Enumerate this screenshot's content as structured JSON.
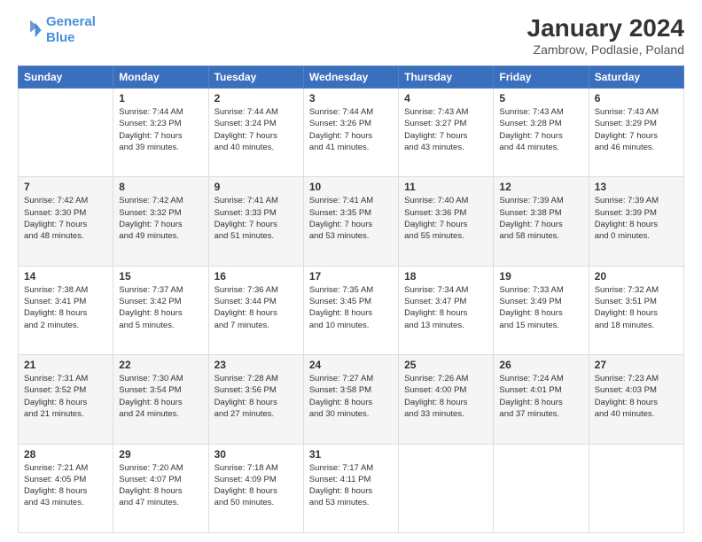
{
  "logo": {
    "line1": "General",
    "line2": "Blue"
  },
  "title": "January 2024",
  "subtitle": "Zambrow, Podlasie, Poland",
  "days_header": [
    "Sunday",
    "Monday",
    "Tuesday",
    "Wednesday",
    "Thursday",
    "Friday",
    "Saturday"
  ],
  "weeks": [
    [
      {
        "num": "",
        "info": ""
      },
      {
        "num": "1",
        "info": "Sunrise: 7:44 AM\nSunset: 3:23 PM\nDaylight: 7 hours\nand 39 minutes."
      },
      {
        "num": "2",
        "info": "Sunrise: 7:44 AM\nSunset: 3:24 PM\nDaylight: 7 hours\nand 40 minutes."
      },
      {
        "num": "3",
        "info": "Sunrise: 7:44 AM\nSunset: 3:26 PM\nDaylight: 7 hours\nand 41 minutes."
      },
      {
        "num": "4",
        "info": "Sunrise: 7:43 AM\nSunset: 3:27 PM\nDaylight: 7 hours\nand 43 minutes."
      },
      {
        "num": "5",
        "info": "Sunrise: 7:43 AM\nSunset: 3:28 PM\nDaylight: 7 hours\nand 44 minutes."
      },
      {
        "num": "6",
        "info": "Sunrise: 7:43 AM\nSunset: 3:29 PM\nDaylight: 7 hours\nand 46 minutes."
      }
    ],
    [
      {
        "num": "7",
        "info": "Sunrise: 7:42 AM\nSunset: 3:30 PM\nDaylight: 7 hours\nand 48 minutes."
      },
      {
        "num": "8",
        "info": "Sunrise: 7:42 AM\nSunset: 3:32 PM\nDaylight: 7 hours\nand 49 minutes."
      },
      {
        "num": "9",
        "info": "Sunrise: 7:41 AM\nSunset: 3:33 PM\nDaylight: 7 hours\nand 51 minutes."
      },
      {
        "num": "10",
        "info": "Sunrise: 7:41 AM\nSunset: 3:35 PM\nDaylight: 7 hours\nand 53 minutes."
      },
      {
        "num": "11",
        "info": "Sunrise: 7:40 AM\nSunset: 3:36 PM\nDaylight: 7 hours\nand 55 minutes."
      },
      {
        "num": "12",
        "info": "Sunrise: 7:39 AM\nSunset: 3:38 PM\nDaylight: 7 hours\nand 58 minutes."
      },
      {
        "num": "13",
        "info": "Sunrise: 7:39 AM\nSunset: 3:39 PM\nDaylight: 8 hours\nand 0 minutes."
      }
    ],
    [
      {
        "num": "14",
        "info": "Sunrise: 7:38 AM\nSunset: 3:41 PM\nDaylight: 8 hours\nand 2 minutes."
      },
      {
        "num": "15",
        "info": "Sunrise: 7:37 AM\nSunset: 3:42 PM\nDaylight: 8 hours\nand 5 minutes."
      },
      {
        "num": "16",
        "info": "Sunrise: 7:36 AM\nSunset: 3:44 PM\nDaylight: 8 hours\nand 7 minutes."
      },
      {
        "num": "17",
        "info": "Sunrise: 7:35 AM\nSunset: 3:45 PM\nDaylight: 8 hours\nand 10 minutes."
      },
      {
        "num": "18",
        "info": "Sunrise: 7:34 AM\nSunset: 3:47 PM\nDaylight: 8 hours\nand 13 minutes."
      },
      {
        "num": "19",
        "info": "Sunrise: 7:33 AM\nSunset: 3:49 PM\nDaylight: 8 hours\nand 15 minutes."
      },
      {
        "num": "20",
        "info": "Sunrise: 7:32 AM\nSunset: 3:51 PM\nDaylight: 8 hours\nand 18 minutes."
      }
    ],
    [
      {
        "num": "21",
        "info": "Sunrise: 7:31 AM\nSunset: 3:52 PM\nDaylight: 8 hours\nand 21 minutes."
      },
      {
        "num": "22",
        "info": "Sunrise: 7:30 AM\nSunset: 3:54 PM\nDaylight: 8 hours\nand 24 minutes."
      },
      {
        "num": "23",
        "info": "Sunrise: 7:28 AM\nSunset: 3:56 PM\nDaylight: 8 hours\nand 27 minutes."
      },
      {
        "num": "24",
        "info": "Sunrise: 7:27 AM\nSunset: 3:58 PM\nDaylight: 8 hours\nand 30 minutes."
      },
      {
        "num": "25",
        "info": "Sunrise: 7:26 AM\nSunset: 4:00 PM\nDaylight: 8 hours\nand 33 minutes."
      },
      {
        "num": "26",
        "info": "Sunrise: 7:24 AM\nSunset: 4:01 PM\nDaylight: 8 hours\nand 37 minutes."
      },
      {
        "num": "27",
        "info": "Sunrise: 7:23 AM\nSunset: 4:03 PM\nDaylight: 8 hours\nand 40 minutes."
      }
    ],
    [
      {
        "num": "28",
        "info": "Sunrise: 7:21 AM\nSunset: 4:05 PM\nDaylight: 8 hours\nand 43 minutes."
      },
      {
        "num": "29",
        "info": "Sunrise: 7:20 AM\nSunset: 4:07 PM\nDaylight: 8 hours\nand 47 minutes."
      },
      {
        "num": "30",
        "info": "Sunrise: 7:18 AM\nSunset: 4:09 PM\nDaylight: 8 hours\nand 50 minutes."
      },
      {
        "num": "31",
        "info": "Sunrise: 7:17 AM\nSunset: 4:11 PM\nDaylight: 8 hours\nand 53 minutes."
      },
      {
        "num": "",
        "info": ""
      },
      {
        "num": "",
        "info": ""
      },
      {
        "num": "",
        "info": ""
      }
    ]
  ]
}
